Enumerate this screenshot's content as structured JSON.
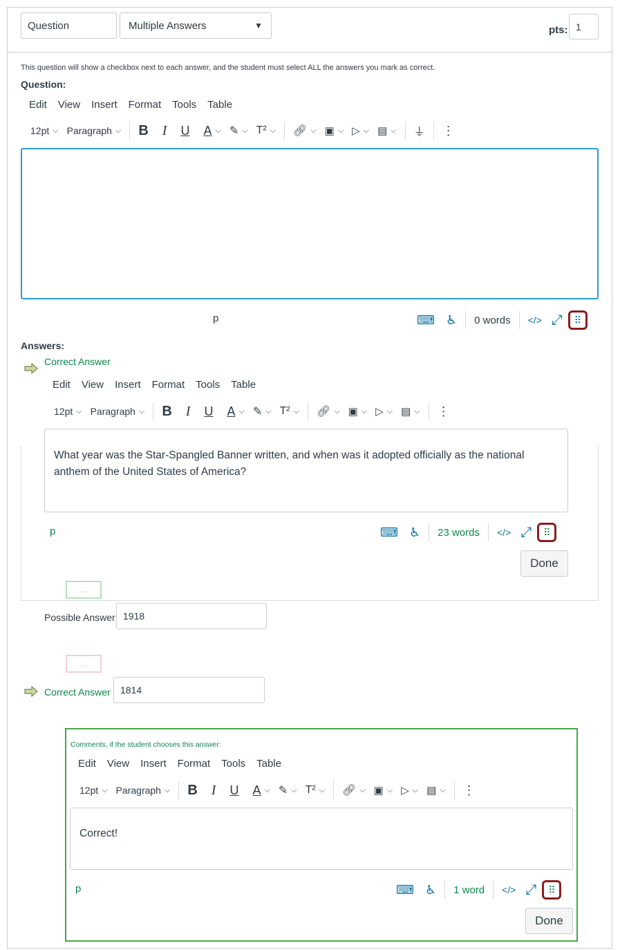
{
  "header": {
    "title_value": "Question",
    "type_select": "Multiple Answers",
    "pts_label": "pts:",
    "pts_value": "1"
  },
  "instructions": "This question will show a checkbox next to each answer, and the student must select ALL the answers you mark as correct.",
  "question_label": "Question:",
  "menus": [
    "Edit",
    "View",
    "Insert",
    "Format",
    "Tools",
    "Table"
  ],
  "toolbar": {
    "font_size": "12pt",
    "block": "Paragraph",
    "bold": "B",
    "italic": "I",
    "underline": "U",
    "text_color": "A",
    "superscript": "T²",
    "more": "⋮"
  },
  "question_editor": {
    "content": "",
    "path": "p",
    "word_count": "0 words",
    "html_toggle": "</>"
  },
  "answers_label": "Answers:",
  "answer1": {
    "label": "Correct Answer",
    "content": "What year was the Star-Spangled Banner written, and when was it adopted officially as the national anthem of the United States of America?",
    "path": "p",
    "word_count": "23 words",
    "html_toggle": "</>",
    "done": "Done",
    "dots": "..."
  },
  "answer2": {
    "label": "Possible Answer",
    "value": "1918",
    "dots": "..."
  },
  "answer3": {
    "label": "Correct Answer",
    "value": "1814"
  },
  "comments": {
    "label": "Comments, if the student chooses this answer:",
    "content": "Correct!",
    "path": "p",
    "word_count": "1 word",
    "html_toggle": "</>",
    "done": "Done"
  },
  "colors": {
    "accent_blue": "#0770a3",
    "focus_blue": "#2b9bd8",
    "green": "#0b874b",
    "highlight_red": "#8b1d1d"
  }
}
